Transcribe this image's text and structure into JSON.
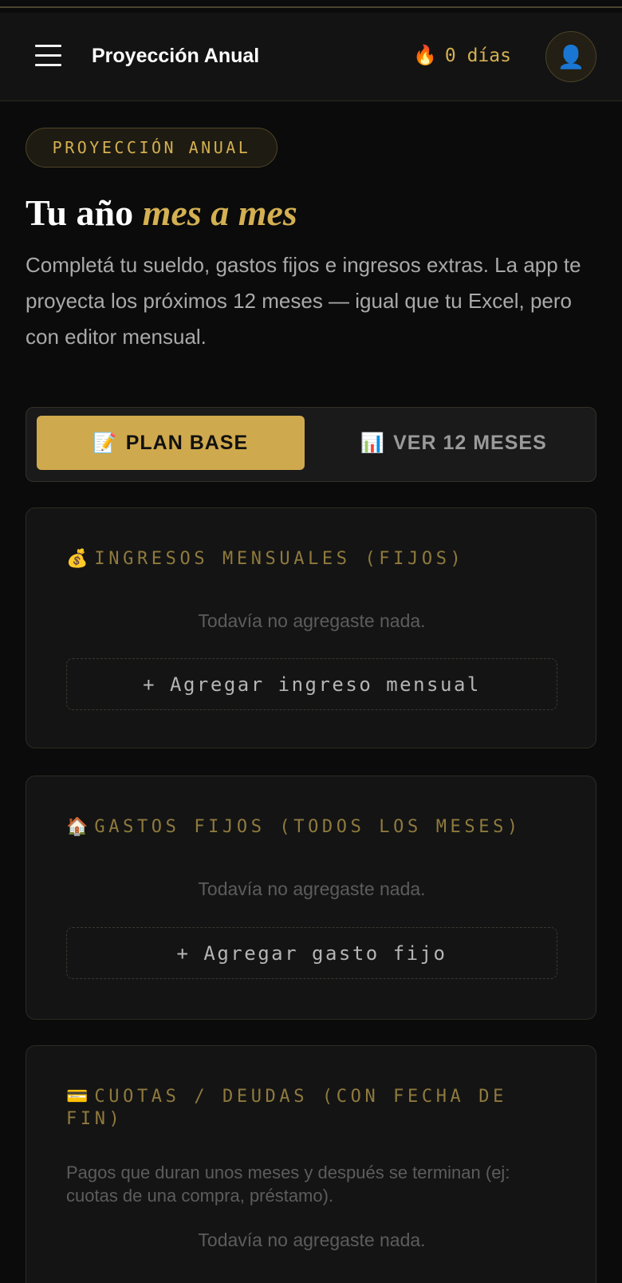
{
  "header": {
    "title": "Proyección Anual",
    "streak_icon": "🔥",
    "streak_text": "0 días",
    "avatar_icon": "👤"
  },
  "hero": {
    "eyebrow": "PROYECCIÓN ANUAL",
    "title_plain": "Tu año ",
    "title_accent": "mes a mes",
    "description": "Completá tu sueldo, gastos fijos e ingresos extras. La app te proyecta los próximos 12 meses — igual que tu Excel, pero con editor mensual."
  },
  "tabs": [
    {
      "icon": "📝",
      "label": "PLAN BASE",
      "active": true
    },
    {
      "icon": "📊",
      "label": "VER 12 MESES",
      "active": false
    }
  ],
  "sections": {
    "ingresos": {
      "icon": "💰",
      "title": "INGRESOS MENSUALES (FIJOS)",
      "empty": "Todavía no agregaste nada.",
      "add_label": "+ Agregar ingreso mensual"
    },
    "gastos": {
      "icon": "🏠",
      "title": "GASTOS FIJOS (TODOS LOS MESES)",
      "empty": "Todavía no agregaste nada.",
      "add_label": "+ Agregar gasto fijo"
    },
    "cuotas": {
      "icon": "💳",
      "title": "CUOTAS / DEUDAS (CON FECHA DE FIN)",
      "note": "Pagos que duran unos meses y después se terminan (ej: cuotas de una compra, préstamo).",
      "empty": "Todavía no agregaste nada."
    }
  },
  "colors": {
    "accent": "#cfa94d",
    "background": "#0b0b0b",
    "card": "#141414"
  }
}
